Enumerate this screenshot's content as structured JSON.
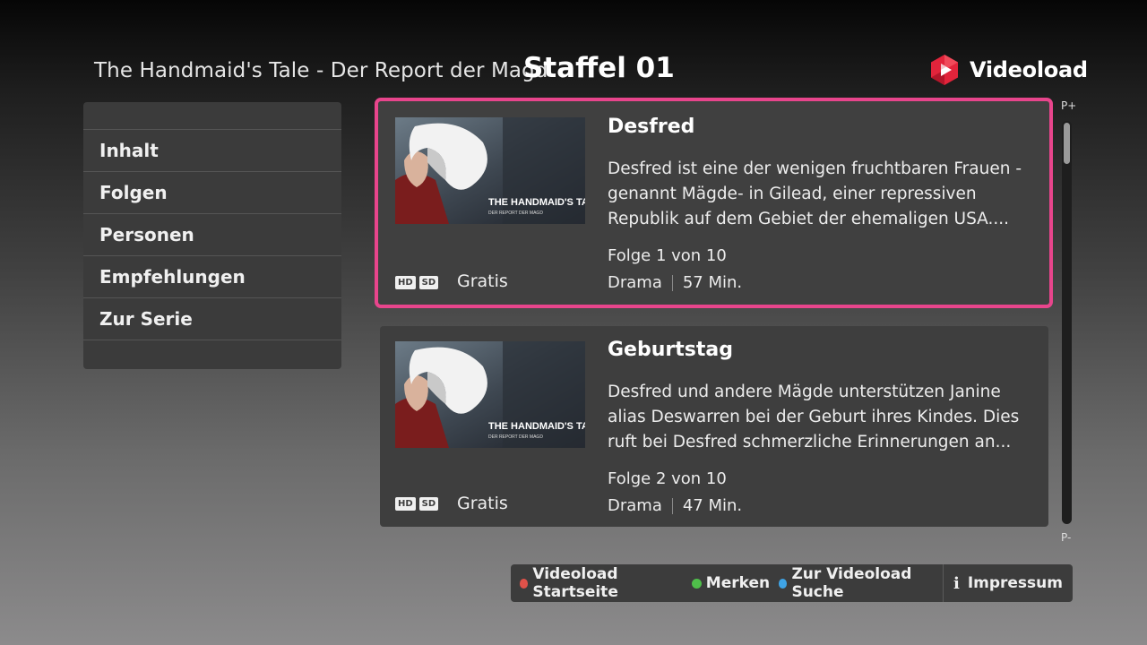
{
  "header": {
    "series_title": "The Handmaid's Tale - Der Report der Magd",
    "season": "Staffel 01",
    "logo_text": "Videoload"
  },
  "sidebar": {
    "items": [
      {
        "label": "Inhalt"
      },
      {
        "label": "Folgen"
      },
      {
        "label": "Personen"
      },
      {
        "label": "Empfehlungen"
      },
      {
        "label": "Zur Serie"
      }
    ]
  },
  "episodes": [
    {
      "title": "Desfred",
      "description": "Desfred ist eine der wenigen fruchtbaren Frauen -genannt Mägde- in Gilead, einer repressiven Republik auf dem Gebiet der ehemaligen USA....",
      "episode_label": "Folge 1 von 10",
      "genre": "Drama",
      "duration": "57 Min.",
      "price": "Gratis",
      "badges": [
        "HD",
        "SD"
      ],
      "thumb_text": "THE HANDMAID'S TALE",
      "thumb_sub": "DER REPORT DER MAGD",
      "selected": true
    },
    {
      "title": "Geburtstag",
      "description": "Desfred und andere Mägde unterstützen Janine alias Deswarren bei der Geburt ihres Kindes. Dies ruft bei Desfred schmerzliche Erinnerungen an...",
      "episode_label": "Folge 2 von 10",
      "genre": "Drama",
      "duration": "47 Min.",
      "price": "Gratis",
      "badges": [
        "HD",
        "SD"
      ],
      "thumb_text": "THE HANDMAID'S TALE",
      "thumb_sub": "DER REPORT DER MAGD",
      "selected": false
    }
  ],
  "scroll": {
    "page_up": "P+",
    "page_down": "P-",
    "position_fraction": 0.0
  },
  "bottom_bar": {
    "red_label": "Videoload Startseite",
    "green_label": "Merken",
    "blue_label": "Zur Videoload Suche",
    "info_label": "Impressum",
    "info_glyph": "i"
  },
  "colors": {
    "highlight": "#e8458c",
    "red_key": "#e0524a",
    "green_key": "#4fbf4a",
    "blue_key": "#3fa4e6",
    "logo_red": "#e2243b"
  },
  "icons": {
    "logo": "videoload-logo-icon",
    "info": "info-icon"
  }
}
